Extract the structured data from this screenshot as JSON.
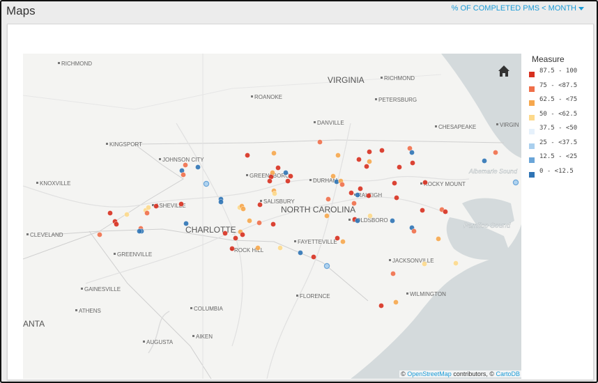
{
  "header": {
    "title": "Maps",
    "measure_label": "% OF COMPLETED PMS < MONTH"
  },
  "legend": {
    "title": "Measure",
    "items": [
      {
        "label": "87.5 - 100",
        "color": "#d7301f"
      },
      {
        "label": "75 - <87.5",
        "color": "#ef6f4a"
      },
      {
        "label": "62.5 - <75",
        "color": "#f6a74d"
      },
      {
        "label": "50 - <62.5",
        "color": "#fdd98b"
      },
      {
        "label": "37.5 - <50",
        "color": "#e6f1fb"
      },
      {
        "label": "25 - <37.5",
        "color": "#a9cfee"
      },
      {
        "label": "12.5 - <25",
        "color": "#6aa5d8"
      },
      {
        "label": "0 - <12.5",
        "color": "#2f74b5"
      }
    ]
  },
  "map": {
    "places": {
      "richmond_w": "RICHMOND",
      "virginia": "VIRGINIA",
      "richmond_e": "RICHMOND",
      "roanoke": "ROANOKE",
      "petersburg": "PETERSBURG",
      "chesapeake": "CHESAPEAKE",
      "virgin": "VIRGIN",
      "danville": "DANVILLE",
      "kingsport": "KINGSPORT",
      "johnson_city": "JOHNSON CITY",
      "greensboro": "GREENSBORO",
      "albemarle_sound": "Albemarle Sound",
      "knoxville": "KNOXVILLE",
      "durham": "DURHAM",
      "rocky_mount": "ROCKY MOUNT",
      "raleigh": "RALEIGH",
      "asheville": "ASHEVILLE",
      "salisbury": "SALISBURY",
      "north_carolina": "NORTH CAROLINA",
      "goldsboro": "GOLDSBORO",
      "pamlico_sound": "Pamlico Sound",
      "cleveland": "CLEVELAND",
      "charlotte": "CHARLOTTE",
      "fayetteville": "FAYETTEVILLE",
      "rock_hill": "ROCK HILL",
      "greenville": "GREENVILLE",
      "jacksonville": "JACKSONVILLE",
      "gainesville": "GAINESVILLE",
      "wilmington": "WILMINGTON",
      "florence": "FLORENCE",
      "athens": "ATHENS",
      "columbia": "COLUMBIA",
      "atlanta": "ANTA",
      "augusta": "AUGUSTA",
      "aiken": "AIKEN"
    },
    "attribution": {
      "prefix": "©",
      "osm": "OpenStreetMap",
      "middle": "contributors, ©",
      "carto": "CartoDB"
    },
    "home_icon": "home-icon"
  }
}
